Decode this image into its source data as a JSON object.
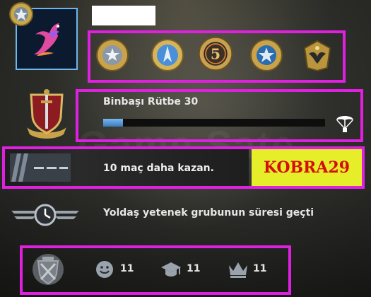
{
  "colors": {
    "highlight": "#e020e0",
    "xp_fill": "#3a7cc0",
    "promo_bg": "#e6ee2a",
    "promo_text": "#d40e0e"
  },
  "watermark": "Game Sate",
  "profile": {
    "name_hidden": "",
    "avatar_icon": "pink-phoenix-icon",
    "badge_icon": "star-medal-icon"
  },
  "medals": [
    "star-wreath-medal-icon",
    "blue-arrow-coin-icon",
    "five-service-coin-icon",
    "blue-star-wreath-medal-icon",
    "gold-eagle-medal-icon"
  ],
  "rank": {
    "label": "Binbaşı Rütbe 30",
    "progress": 0.09,
    "emblem_icon": "shield-sword-emblem-icon",
    "reward_icon": "parachute-icon"
  },
  "wins": {
    "label": "10 maç daha kazan.",
    "promo": "KOBRA29"
  },
  "skill_group": {
    "label": "Yoldaş yetenek grubunun süresi geçti",
    "icon": "clock-wings-icon"
  },
  "commendations": {
    "friendly": "11",
    "teacher": "11",
    "leader": "11"
  }
}
